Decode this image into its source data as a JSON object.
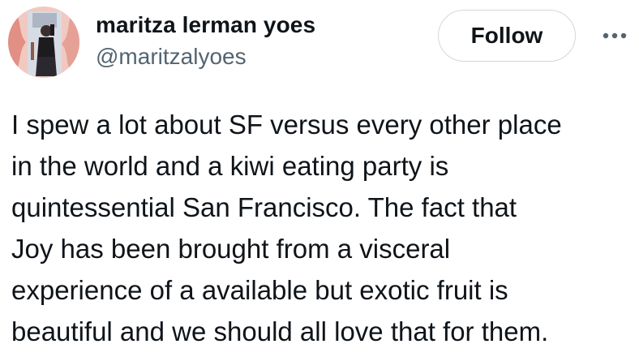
{
  "tweet": {
    "author": {
      "display_name": "maritza lerman yoes",
      "handle": "@maritzalyoes",
      "avatar_icon": "profile-photo"
    },
    "follow_label": "Follow",
    "more_icon": "more-horizontal-icon",
    "text_lines": [
      "I spew a lot about SF versus every other place",
      "in the world and a kiwi eating party is",
      "quintessential San Francisco. The fact that",
      "Joy has been brought from a visceral",
      "experience of a available but exotic fruit is",
      "beautiful and we should all love that for them."
    ]
  },
  "colors": {
    "text_primary": "#0f1419",
    "text_secondary": "#536471",
    "button_border": "#cfd9de",
    "background": "#ffffff"
  }
}
